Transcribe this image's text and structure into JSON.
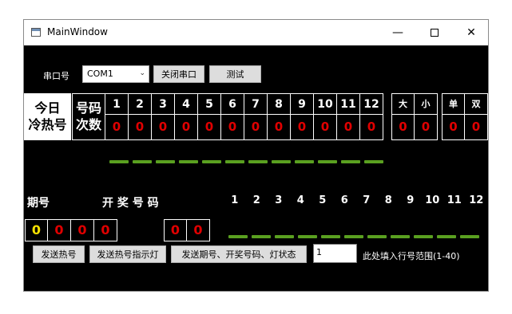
{
  "window": {
    "title": "MainWindow",
    "min_glyph": "—",
    "close_glyph": "✕"
  },
  "serial": {
    "label": "串口号",
    "port_value": "COM1",
    "dropdown_arrow": "⌄",
    "close_port_label": "关闭串口",
    "test_label": "测试"
  },
  "hot_table": {
    "today_line1": "今日",
    "today_line2": "冷热号",
    "count_line1": "号码",
    "count_line2": "次数",
    "columns": [
      {
        "num": "1",
        "count": "0"
      },
      {
        "num": "2",
        "count": "0"
      },
      {
        "num": "3",
        "count": "0"
      },
      {
        "num": "4",
        "count": "0"
      },
      {
        "num": "5",
        "count": "0"
      },
      {
        "num": "6",
        "count": "0"
      },
      {
        "num": "7",
        "count": "0"
      },
      {
        "num": "8",
        "count": "0"
      },
      {
        "num": "9",
        "count": "0"
      },
      {
        "num": "10",
        "count": "0"
      },
      {
        "num": "11",
        "count": "0"
      },
      {
        "num": "12",
        "count": "0"
      }
    ],
    "size_columns": [
      {
        "label": "大",
        "count": "0"
      },
      {
        "label": "小",
        "count": "0"
      }
    ],
    "parity_columns": [
      {
        "label": "单",
        "count": "0"
      },
      {
        "label": "双",
        "count": "0"
      }
    ]
  },
  "indicator_color": "#5aa020",
  "draw": {
    "period_label": "期号",
    "prize_label": "开 奖 号 码",
    "period_digits": [
      "0",
      "0",
      "0",
      "0"
    ],
    "prize_digits": [
      "0",
      "0"
    ],
    "position_numbers": [
      "1",
      "2",
      "3",
      "4",
      "5",
      "6",
      "7",
      "8",
      "9",
      "10",
      "11",
      "12"
    ]
  },
  "actions": {
    "send_hot_label": "发送热号",
    "send_hot_light_label": "发送热号指示灯",
    "send_period_label": "发送期号、开奖号码、灯状态",
    "row_input_value": "1",
    "row_range_hint": "此处填入行号范围(1-40)"
  }
}
